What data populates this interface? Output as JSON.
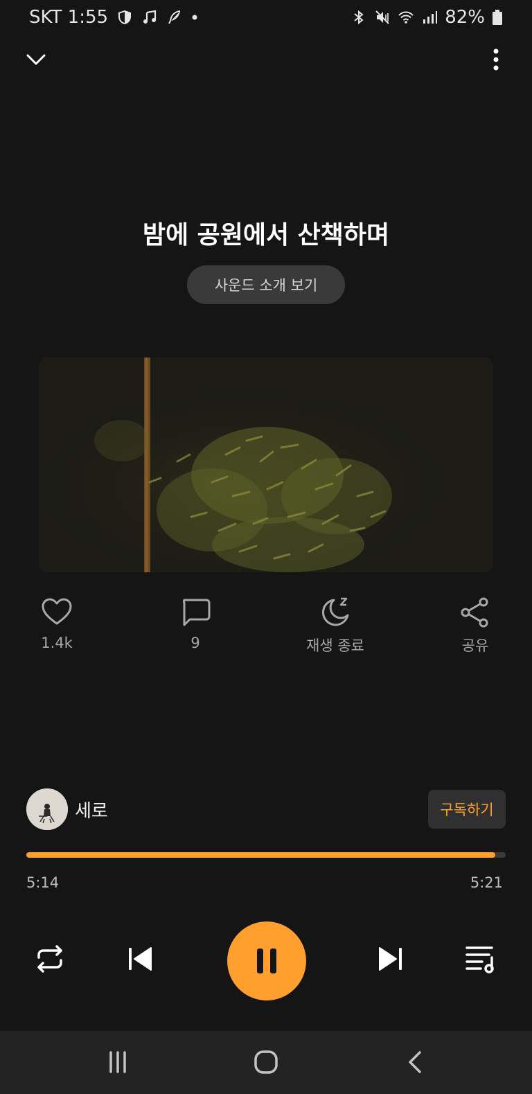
{
  "status_bar": {
    "carrier_time": "SKT 1:55",
    "battery": "82%",
    "icons": [
      "shield-icon",
      "music-note-icon",
      "feather-icon",
      "dot-icon",
      "bluetooth-icon",
      "mute-icon",
      "wifi-icon",
      "signal-icon",
      "battery-icon"
    ]
  },
  "header": {
    "collapse_icon": "chevron-down-icon",
    "more_icon": "more-vertical-icon"
  },
  "track": {
    "title": "밤에 공원에서 산책하며",
    "intro_button": "사운드 소개 보기"
  },
  "actions": [
    {
      "icon": "heart-icon",
      "label": "1.4k"
    },
    {
      "icon": "comment-icon",
      "label": "9"
    },
    {
      "icon": "sleep-timer-icon",
      "label": "재생 종료"
    },
    {
      "icon": "share-icon",
      "label": "공유"
    }
  ],
  "artist": {
    "name": "세로",
    "subscribe_label": "구독하기"
  },
  "playback": {
    "elapsed": "5:14",
    "duration": "5:21",
    "progress": 0.978
  },
  "controls": [
    "repeat-icon",
    "previous-icon",
    "pause-icon",
    "next-icon",
    "playlist-icon"
  ],
  "nav": [
    "recent-apps-icon",
    "home-icon",
    "back-icon"
  ],
  "colors": {
    "background": "#151515",
    "accent": "#ff9f2e",
    "button_bg": "#3a3a3a",
    "nav_bg": "#232323"
  }
}
